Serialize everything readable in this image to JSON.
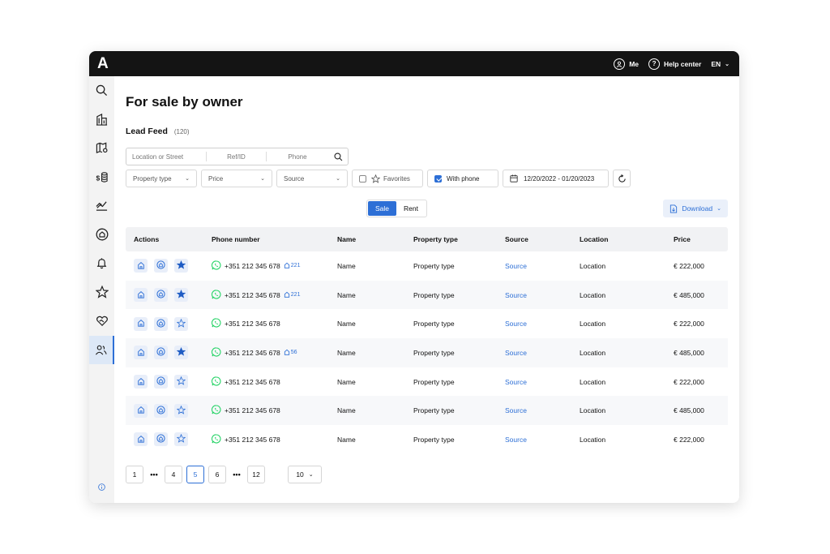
{
  "topbar": {
    "logo": "A",
    "me_label": "Me",
    "help_label": "Help center",
    "lang": "EN"
  },
  "page": {
    "title": "For sale by owner",
    "feed_title": "Lead Feed",
    "feed_count": "(120)"
  },
  "search": {
    "location_placeholder": "Location or Street",
    "ref_placeholder": "Ref/ID",
    "phone_placeholder": "Phone"
  },
  "filters": {
    "property_type": "Property type",
    "price": "Price",
    "source": "Source",
    "favorites": "Favorites",
    "with_phone": "With phone",
    "date_range": "12/20/2022 - 01/20/2023"
  },
  "toggle": {
    "sale": "Sale",
    "rent": "Rent"
  },
  "download_label": "Download",
  "table": {
    "headers": {
      "actions": "Actions",
      "phone": "Phone number",
      "name": "Name",
      "type": "Property type",
      "source": "Source",
      "location": "Location",
      "price": "Price"
    },
    "rows": [
      {
        "phone": "+351 212 345 678",
        "count": "221",
        "name": "Name",
        "type": "Property type",
        "source": "Source",
        "location": "Location",
        "price": "€ 222,000",
        "favorite": true
      },
      {
        "phone": "+351 212 345 678",
        "count": "221",
        "name": "Name",
        "type": "Property type",
        "source": "Source",
        "location": "Location",
        "price": "€ 485,000",
        "favorite": true
      },
      {
        "phone": "+351 212 345 678",
        "count": "",
        "name": "Name",
        "type": "Property type",
        "source": "Source",
        "location": "Location",
        "price": "€ 222,000",
        "favorite": false
      },
      {
        "phone": "+351 212 345 678",
        "count": "56",
        "name": "Name",
        "type": "Property type",
        "source": "Source",
        "location": "Location",
        "price": "€ 485,000",
        "favorite": true
      },
      {
        "phone": "+351 212 345 678",
        "count": "",
        "name": "Name",
        "type": "Property type",
        "source": "Source",
        "location": "Location",
        "price": "€ 222,000",
        "favorite": false
      },
      {
        "phone": "+351 212 345 678",
        "count": "",
        "name": "Name",
        "type": "Property type",
        "source": "Source",
        "location": "Location",
        "price": "€ 485,000",
        "favorite": false
      },
      {
        "phone": "+351 212 345 678",
        "count": "",
        "name": "Name",
        "type": "Property type",
        "source": "Source",
        "location": "Location",
        "price": "€ 222,000",
        "favorite": false
      }
    ]
  },
  "pagination": {
    "first": "1",
    "p4": "4",
    "p5": "5",
    "p6": "6",
    "last": "12",
    "per_page": "10",
    "dots": "•••"
  },
  "colors": {
    "accent": "#2d6fd6",
    "topbar": "#141414",
    "whatsapp": "#25d366"
  }
}
